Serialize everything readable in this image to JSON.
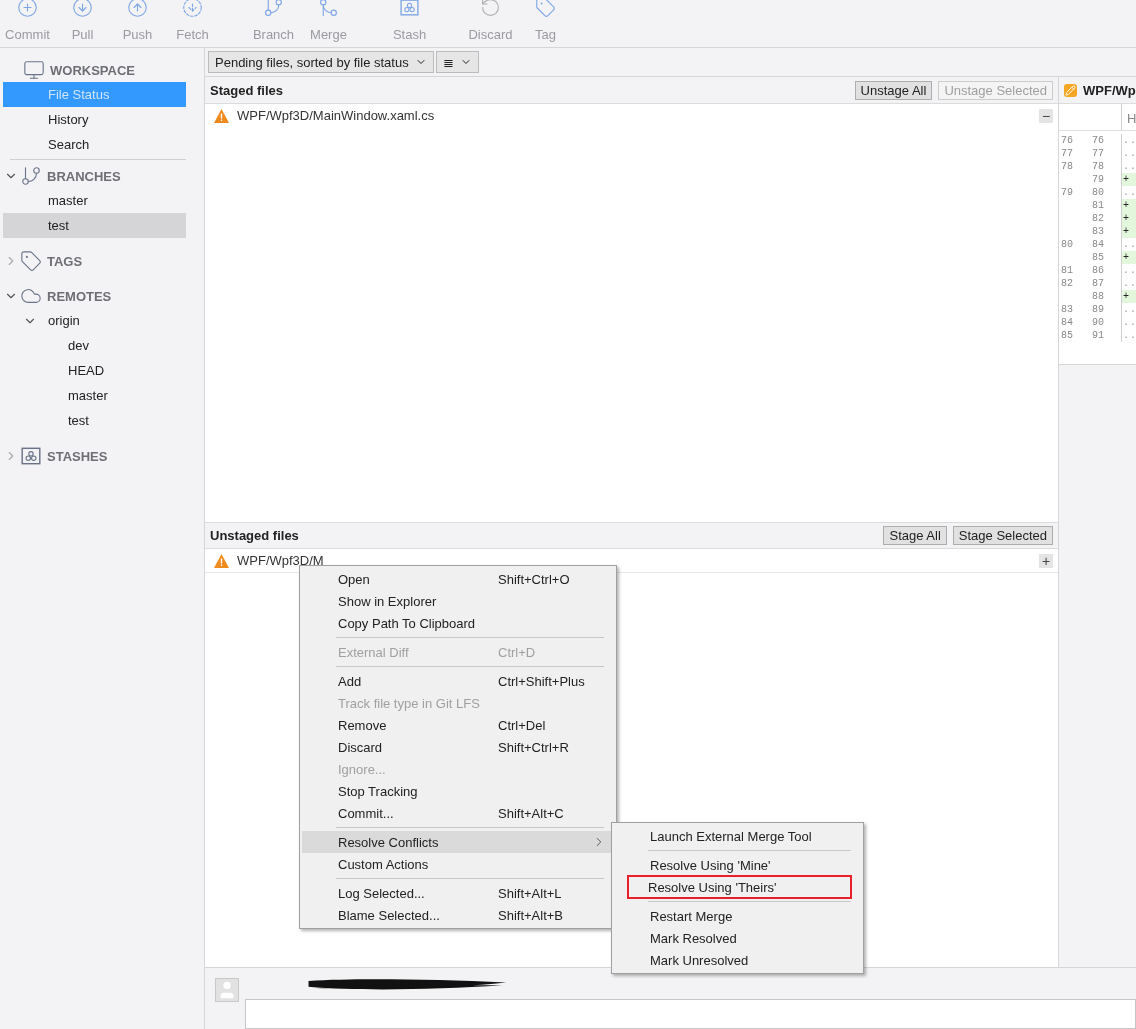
{
  "toolbar": {
    "groups": [
      [
        {
          "label": "Commit"
        },
        {
          "label": "Pull"
        },
        {
          "label": "Push"
        },
        {
          "label": "Fetch"
        }
      ],
      [
        {
          "label": "Branch"
        },
        {
          "label": "Merge"
        }
      ],
      [
        {
          "label": "Stash"
        }
      ],
      [
        {
          "label": "Discard"
        },
        {
          "label": "Tag"
        }
      ]
    ]
  },
  "sidebar": {
    "sections": [
      {
        "title": "WORKSPACE",
        "items": [
          {
            "label": "File Status",
            "selected": true
          },
          {
            "label": "History",
            "selected": false
          },
          {
            "label": "Search",
            "selected": false
          }
        ]
      },
      {
        "title": "BRANCHES",
        "expanded": true,
        "items": [
          {
            "label": "master",
            "selected": false
          },
          {
            "label": "test",
            "selected": false,
            "highlighted": true
          }
        ]
      },
      {
        "title": "TAGS",
        "expanded": false
      },
      {
        "title": "REMOTES",
        "expanded": true,
        "items": [
          {
            "label": "origin",
            "selected": false,
            "expanded": true,
            "children": [
              {
                "label": "dev",
                "selected": false
              },
              {
                "label": "HEAD",
                "selected": false
              },
              {
                "label": "master",
                "selected": false
              },
              {
                "label": "test",
                "selected": false
              }
            ]
          }
        ]
      },
      {
        "title": "STASHES",
        "expanded": false
      }
    ]
  },
  "filter": {
    "sort_dropdown": "Pending files, sorted by file status",
    "view_dropdown": "≣"
  },
  "staged": {
    "title": "Staged files",
    "buttons": [
      {
        "label": "Unstage All",
        "disabled": false
      },
      {
        "label": "Unstage Selected",
        "disabled": true
      }
    ],
    "files": [
      {
        "path": "WPF/Wpf3D/MainWindow.xaml.cs",
        "action": "−"
      }
    ]
  },
  "unstaged": {
    "title": "Unstaged files",
    "buttons": [
      {
        "label": "Stage All",
        "disabled": false
      },
      {
        "label": "Stage Selected",
        "disabled": false
      }
    ],
    "files": [
      {
        "path": "WPF/Wpf3D/M",
        "action": "+"
      }
    ]
  },
  "diff": {
    "file": "WPF/Wp",
    "column_header": "H",
    "lines": [
      {
        "old": "76",
        "new": "76",
        "kind": "context",
        "marker": ".."
      },
      {
        "old": "77",
        "new": "77",
        "kind": "context",
        "marker": ".."
      },
      {
        "old": "78",
        "new": "78",
        "kind": "context",
        "marker": ".."
      },
      {
        "new": "79",
        "kind": "added",
        "marker": "+"
      },
      {
        "old": "79",
        "new": "80",
        "kind": "context",
        "marker": ".."
      },
      {
        "new": "81",
        "kind": "added",
        "marker": "+"
      },
      {
        "new": "82",
        "kind": "added",
        "marker": "+"
      },
      {
        "new": "83",
        "kind": "added",
        "marker": "+"
      },
      {
        "old": "80",
        "new": "84",
        "kind": "context",
        "marker": ".."
      },
      {
        "new": "85",
        "kind": "added",
        "marker": "+"
      },
      {
        "old": "81",
        "new": "86",
        "kind": "context",
        "marker": ".."
      },
      {
        "old": "82",
        "new": "87",
        "kind": "context",
        "marker": ".."
      },
      {
        "new": "88",
        "kind": "added",
        "marker": "+"
      },
      {
        "old": "83",
        "new": "89",
        "kind": "context",
        "marker": ".."
      },
      {
        "old": "84",
        "new": "90",
        "kind": "context",
        "marker": ".."
      },
      {
        "old": "85",
        "new": "91",
        "kind": "context",
        "marker": ".."
      }
    ]
  },
  "context_menu": {
    "items": [
      {
        "kind": "item",
        "label": "Open",
        "shortcut": "Shift+Ctrl+O",
        "disabled": false
      },
      {
        "kind": "item",
        "label": "Show in Explorer",
        "disabled": false
      },
      {
        "kind": "item",
        "label": "Copy Path To Clipboard",
        "disabled": false
      },
      {
        "kind": "separator"
      },
      {
        "kind": "item",
        "label": "External Diff",
        "shortcut": "Ctrl+D",
        "disabled": true
      },
      {
        "kind": "separator"
      },
      {
        "kind": "item",
        "label": "Add",
        "shortcut": "Ctrl+Shift+Plus",
        "disabled": false
      },
      {
        "kind": "item",
        "label": "Track file type in Git LFS",
        "disabled": true
      },
      {
        "kind": "item",
        "label": "Remove",
        "shortcut": "Ctrl+Del",
        "disabled": false
      },
      {
        "kind": "item",
        "label": "Discard",
        "shortcut": "Shift+Ctrl+R",
        "disabled": false
      },
      {
        "kind": "item",
        "label": "Ignore...",
        "disabled": true
      },
      {
        "kind": "item",
        "label": "Stop Tracking",
        "disabled": false
      },
      {
        "kind": "item",
        "label": "Commit...",
        "shortcut": "Shift+Alt+C",
        "disabled": false
      },
      {
        "kind": "separator"
      },
      {
        "kind": "submenu",
        "label": "Resolve Conflicts",
        "selected": true
      },
      {
        "kind": "item",
        "label": "Custom Actions",
        "disabled": false
      },
      {
        "kind": "separator"
      },
      {
        "kind": "item",
        "label": "Log Selected...",
        "shortcut": "Shift+Alt+L",
        "disabled": false
      },
      {
        "kind": "item",
        "label": "Blame Selected...",
        "shortcut": "Shift+Alt+B",
        "disabled": false
      }
    ]
  },
  "submenu": {
    "items": [
      {
        "kind": "item",
        "label": "Launch External Merge Tool",
        "highlighted": false
      },
      {
        "kind": "separator"
      },
      {
        "kind": "item",
        "label": "Resolve Using 'Mine'",
        "highlighted": false
      },
      {
        "kind": "item",
        "label": "Resolve Using 'Theirs'",
        "highlighted": true
      },
      {
        "kind": "separator"
      },
      {
        "kind": "item",
        "label": "Restart Merge",
        "highlighted": false
      },
      {
        "kind": "item",
        "label": "Mark Resolved",
        "highlighted": false
      },
      {
        "kind": "item",
        "label": "Mark Unresolved",
        "highlighted": false
      }
    ]
  }
}
